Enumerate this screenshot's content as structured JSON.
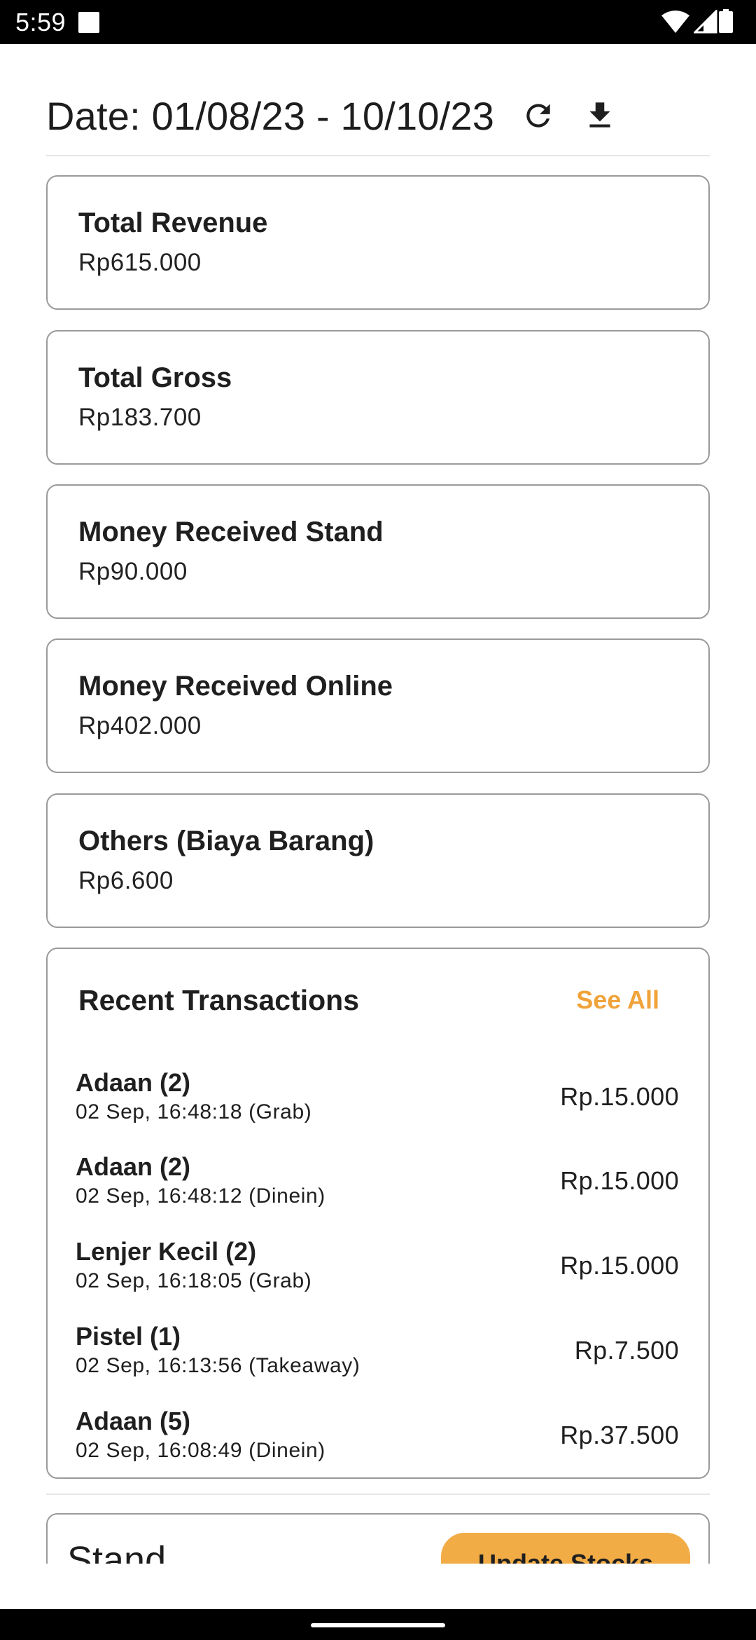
{
  "status_bar": {
    "time": "5:59",
    "icons": [
      "notification-square-icon",
      "wifi-icon",
      "signal-icon",
      "battery-icon"
    ]
  },
  "header": {
    "date_range": "Date: 01/08/23 - 10/10/23",
    "icons": [
      "refresh-icon",
      "download-icon"
    ]
  },
  "stats": [
    {
      "title": "Total Revenue",
      "value": "Rp615.000"
    },
    {
      "title": "Total Gross",
      "value": "Rp183.700"
    },
    {
      "title": "Money Received Stand",
      "value": "Rp90.000"
    },
    {
      "title": "Money Received Online",
      "value": "Rp402.000"
    },
    {
      "title": "Others (Biaya Barang)",
      "value": "Rp6.600"
    }
  ],
  "recent": {
    "title": "Recent Transactions",
    "see_all": "See All",
    "transactions": [
      {
        "name": "Adaan (2)",
        "meta": "02 Sep, 16:48:18 (Grab)",
        "amount": "Rp.15.000"
      },
      {
        "name": "Adaan (2)",
        "meta": "02 Sep, 16:48:12 (Dinein)",
        "amount": "Rp.15.000"
      },
      {
        "name": "Lenjer Kecil (2)",
        "meta": "02 Sep, 16:18:05 (Grab)",
        "amount": "Rp.15.000"
      },
      {
        "name": "Pistel (1)",
        "meta": "02 Sep, 16:13:56 (Takeaway)",
        "amount": "Rp.7.500"
      },
      {
        "name": "Adaan (5)",
        "meta": "02 Sep, 16:08:49 (Dinein)",
        "amount": "Rp.37.500"
      }
    ]
  },
  "stand": {
    "title": "Stand",
    "update_button": "Update Stocks"
  },
  "colors": {
    "accent": "#f0a33a",
    "button": "#f2ac45",
    "card_border": "#9a9a9a"
  }
}
